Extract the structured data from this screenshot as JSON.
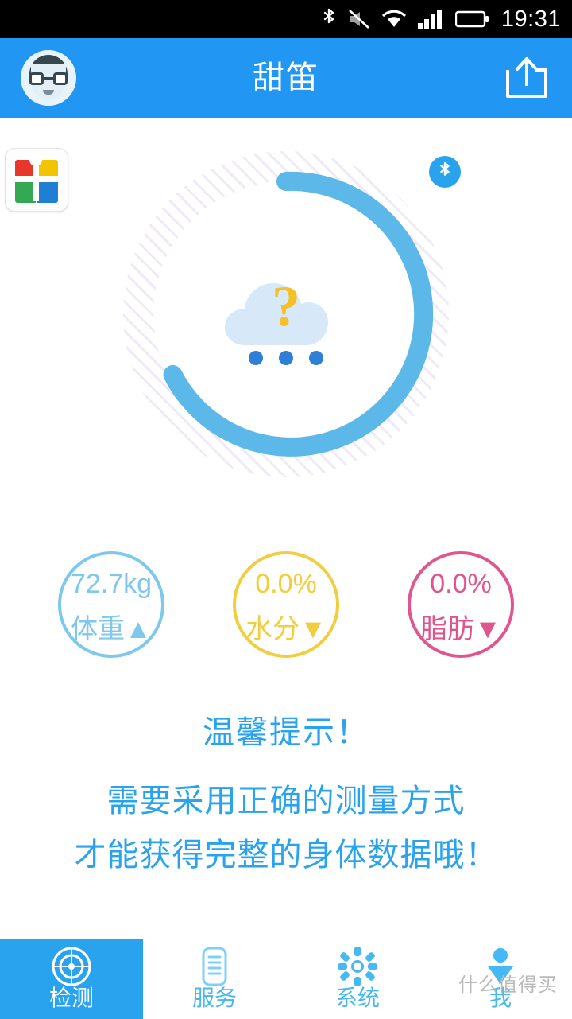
{
  "statusbar": {
    "time": "19:31",
    "icons": [
      "bluetooth-icon",
      "mute-icon",
      "wifi-icon",
      "signal-icon",
      "battery-icon"
    ]
  },
  "appbar": {
    "title": "甜笛",
    "avatar_icon": "user-avatar",
    "share_icon": "share-icon"
  },
  "content": {
    "brand_logo_icon": "windows-style-logo",
    "bluetooth_badge_icon": "bluetooth-icon",
    "gauge": {
      "cloud_icon": "cloud-icon",
      "question_mark": "?",
      "ring_color": "#5cb8e8",
      "track_color": "#efeaf6"
    },
    "metrics": [
      {
        "value": "72.7kg",
        "label": "体重",
        "arrow": "▲",
        "color": "#7ec8ec"
      },
      {
        "value": "0.0%",
        "label": "水分",
        "arrow": "▼",
        "color": "#f2cd3e"
      },
      {
        "value": "0.0%",
        "label": "脂肪",
        "arrow": "▼",
        "color": "#e0558e"
      }
    ],
    "tips": {
      "heading": "温馨提示！",
      "line1": "需要采用正确的测量方式",
      "line2": "才能获得完整的身体数据哦！"
    }
  },
  "navbar": {
    "items": [
      {
        "label": "检测",
        "icon": "radar-icon",
        "active": true
      },
      {
        "label": "服务",
        "icon": "document-icon",
        "active": false
      },
      {
        "label": "系统",
        "icon": "gear-icon",
        "active": false
      },
      {
        "label": "我",
        "icon": "pin-person-icon",
        "active": false
      }
    ]
  },
  "watermark": "什么值得买"
}
